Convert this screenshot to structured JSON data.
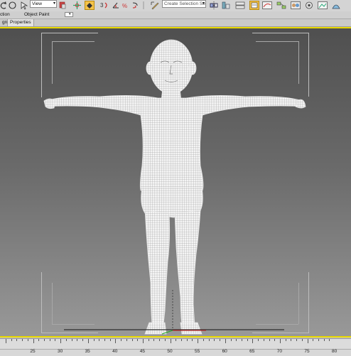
{
  "toolbar": {
    "view_dropdown": "View",
    "selection_set_placeholder": "Create Selection Se",
    "icons": [
      "undo-icon",
      "ref-coord-icon",
      "move-icon",
      "select-region-icon",
      "snap-icon",
      "angle-snap-icon",
      "percent-snap-icon",
      "spinner-snap-icon",
      "edit-named-sel-icon",
      "mirror-icon",
      "align-icon",
      "layer-icon",
      "graphite-icon",
      "curve-editor-icon",
      "schematic-icon",
      "material-editor-icon",
      "render-setup-icon",
      "render-frame-icon",
      "render-icon"
    ],
    "accent": "#f4c34a"
  },
  "ribbon": {
    "left_label": "ction",
    "object_paint_label": "Object Paint"
  },
  "panel_tabs": [
    "gn",
    "Properties"
  ],
  "viewport": {
    "border_color": "#e8d800",
    "background_top": "#4f4f4f",
    "background_bottom": "#999999"
  },
  "timeline": {
    "tick_labels": [
      "25",
      "30",
      "35",
      "40",
      "45",
      "50",
      "55",
      "60",
      "65",
      "70",
      "75",
      "80"
    ]
  }
}
